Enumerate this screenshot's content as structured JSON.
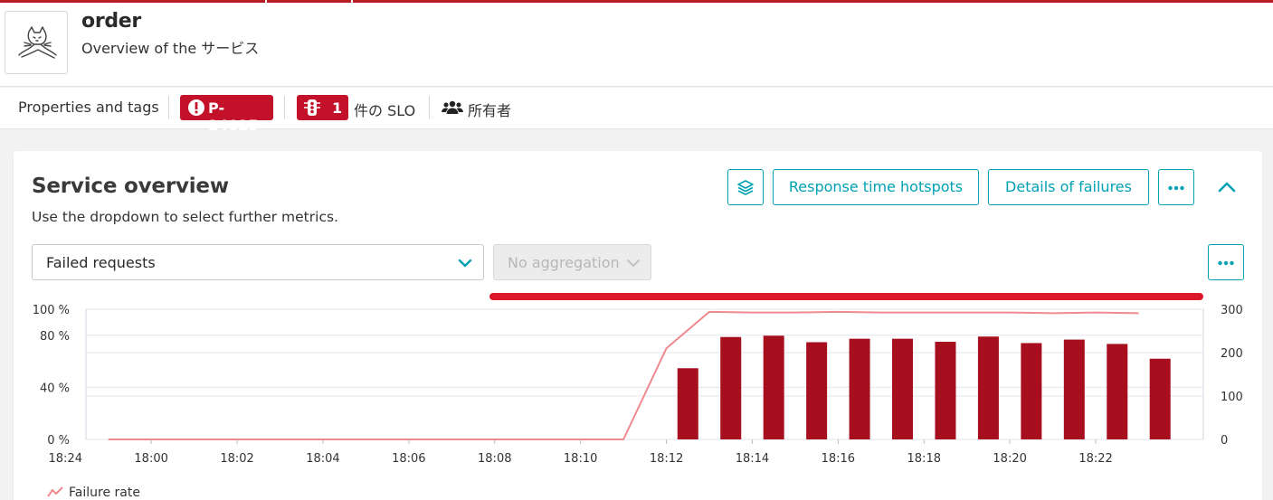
{
  "header": {
    "title": "order",
    "subtitle": "Overview of the サービス"
  },
  "tagbar": {
    "properties_label": "Properties and tags",
    "problem_badge": "P-24025",
    "slo_count": "1",
    "slo_label": "件の SLO",
    "owners_label": "所有者"
  },
  "card": {
    "title": "Service overview",
    "subtitle": "Use the dropdown to select further metrics.",
    "buttons": {
      "response_hotspots": "Response time hotspots",
      "failure_details": "Details of failures"
    },
    "metric_select": {
      "value": "Failed requests"
    },
    "aggregation_select": {
      "value": "No aggregation",
      "disabled": true
    }
  },
  "colors": {
    "accent": "#00a1b2",
    "bars": "#a70f1f",
    "failure_line": "#f08a8e",
    "problem": "#dc172a"
  },
  "chart_data": {
    "type": "bar",
    "xlabel": "",
    "ylabel_left": "",
    "ylabel_right": "",
    "x_ticks": [
      "18:00",
      "18:02",
      "18:04",
      "18:06",
      "18:08",
      "18:10",
      "18:12",
      "18:14",
      "18:16",
      "18:18",
      "18:20",
      "18:22",
      "18:24"
    ],
    "y_left_ticks": [
      "0 %",
      "40 %",
      "80 %",
      "100 %"
    ],
    "y_left_lim": [
      0,
      100
    ],
    "y_right_ticks": [
      "0",
      "100",
      "200",
      "300"
    ],
    "y_right_lim": [
      0,
      300
    ],
    "grid": true,
    "minute_labels": [
      "17:59",
      "18:00",
      "18:01",
      "18:02",
      "18:03",
      "18:04",
      "18:05",
      "18:06",
      "18:07",
      "18:08",
      "18:09",
      "18:10",
      "18:11",
      "18:12",
      "18:13",
      "18:14",
      "18:15",
      "18:16",
      "18:17",
      "18:18",
      "18:19",
      "18:20",
      "18:21",
      "18:22",
      "18:23"
    ],
    "series": [
      {
        "name": "Failed requests",
        "kind": "bar",
        "axis": "right",
        "x": [
          "18:12",
          "18:13",
          "18:14",
          "18:15",
          "18:16",
          "18:17",
          "18:18",
          "18:19",
          "18:20",
          "18:21",
          "18:22",
          "18:23"
        ],
        "values": [
          164,
          236,
          239,
          224,
          232,
          232,
          225,
          237,
          222,
          230,
          220,
          186
        ]
      },
      {
        "name": "Failure rate",
        "kind": "line",
        "axis": "left",
        "x": [
          "17:59",
          "18:00",
          "18:01",
          "18:02",
          "18:03",
          "18:04",
          "18:05",
          "18:06",
          "18:07",
          "18:08",
          "18:09",
          "18:10",
          "18:11",
          "18:12",
          "18:13",
          "18:14",
          "18:15",
          "18:16",
          "18:17",
          "18:18",
          "18:19",
          "18:20",
          "18:21",
          "18:22",
          "18:23"
        ],
        "values": [
          0,
          0,
          0,
          0,
          0,
          0,
          0,
          0,
          0,
          0,
          0,
          0,
          0,
          70,
          98,
          97.5,
          97.5,
          98,
          97.5,
          97.5,
          97.5,
          97.5,
          97,
          97.5,
          97
        ]
      }
    ],
    "legend": [
      "Failure rate"
    ]
  }
}
